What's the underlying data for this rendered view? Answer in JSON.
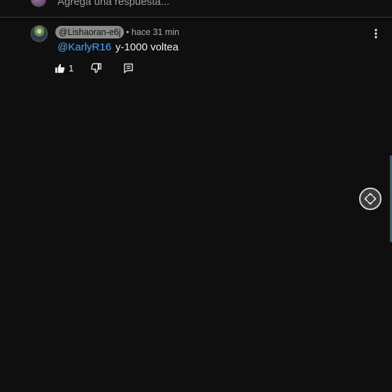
{
  "reply_bar": {
    "placeholder": "Agrega una respuesta..."
  },
  "comment": {
    "handle": "@Lishaoran-e6j",
    "meta": "• hace 31 min",
    "mention": "@KarlyR16",
    "text": "y-1000 voltea",
    "likes": "1"
  },
  "icons": {
    "more": "more-vertical-icon",
    "like": "thumbs-up-icon",
    "dislike": "thumbs-down-icon",
    "reply": "reply-comment-icon",
    "fullscreen": "expand-arrows-icon"
  },
  "colors": {
    "background": "#0f0f0f",
    "mention": "#3ea6ff",
    "handle_pill": "#8a8a8a"
  }
}
